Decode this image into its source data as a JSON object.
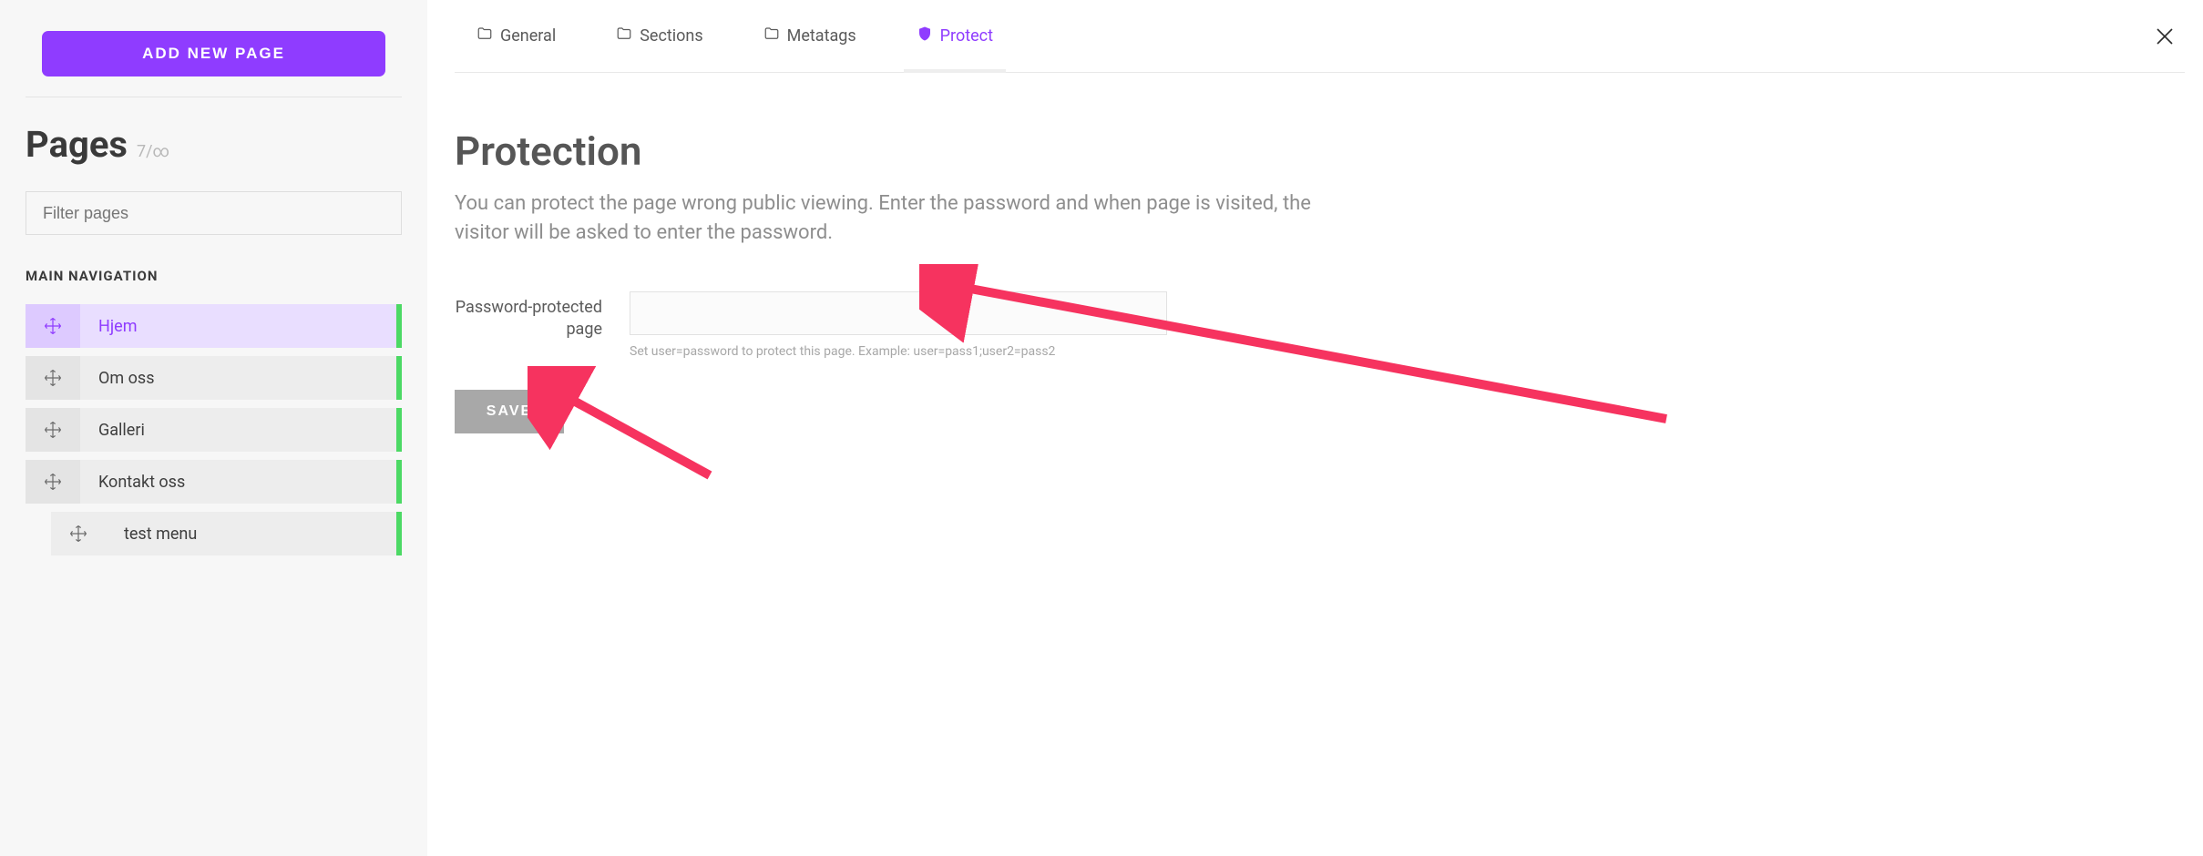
{
  "sidebar": {
    "add_page_label": "ADD NEW PAGE",
    "pages_title": "Pages",
    "pages_count": "7/∞",
    "filter_placeholder": "Filter pages",
    "section_label": "MAIN NAVIGATION",
    "items": [
      {
        "label": "Hjem",
        "active": true,
        "child": false
      },
      {
        "label": "Om oss",
        "active": false,
        "child": false
      },
      {
        "label": "Galleri",
        "active": false,
        "child": false
      },
      {
        "label": "Kontakt oss",
        "active": false,
        "child": false
      },
      {
        "label": "test menu",
        "active": false,
        "child": true
      }
    ]
  },
  "tabs": [
    {
      "label": "General",
      "icon": "folder",
      "active": false
    },
    {
      "label": "Sections",
      "icon": "folder",
      "active": false
    },
    {
      "label": "Metatags",
      "icon": "folder",
      "active": false
    },
    {
      "label": "Protect",
      "icon": "shield",
      "active": true
    }
  ],
  "protection": {
    "heading": "Protection",
    "description": "You can protect the page wrong public viewing. Enter the password and when page is visited, the visitor will be asked to enter the password.",
    "field_label": "Password-protected page",
    "field_value": "",
    "hint": "Set user=password to protect this page. Example: user=pass1;user2=pass2",
    "save_label": "SAVE"
  }
}
